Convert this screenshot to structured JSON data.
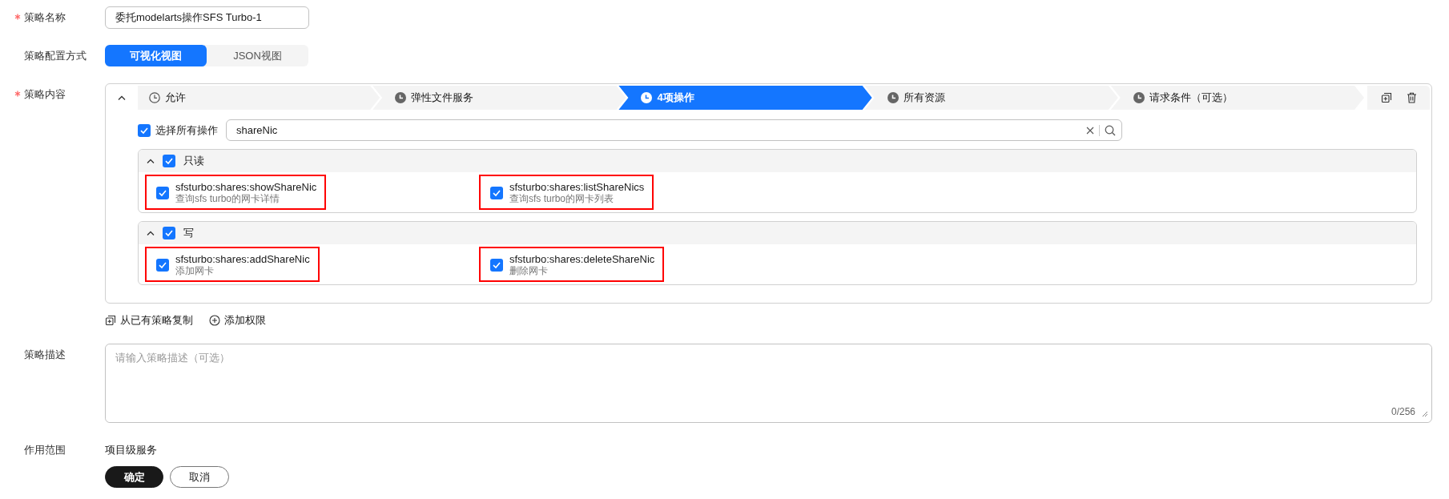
{
  "name_field": {
    "label": "策略名称",
    "required": true,
    "value": "委托modelarts操作SFS Turbo-1"
  },
  "config_mode": {
    "label": "策略配置方式",
    "required": false,
    "options": [
      {
        "label": "可视化视图",
        "selected": true
      },
      {
        "label": "JSON视图",
        "selected": false
      }
    ]
  },
  "policy_content": {
    "label": "策略内容",
    "required": true,
    "expanded": true,
    "steps": [
      {
        "label": "允许",
        "kind": "outline",
        "selected": false
      },
      {
        "label": "弹性文件服务",
        "kind": "filled",
        "selected": false
      },
      {
        "label": "4项操作",
        "kind": "filled",
        "selected": true
      },
      {
        "label": "所有资源",
        "kind": "filled",
        "selected": false
      },
      {
        "label": "请求条件（可选）",
        "kind": "filled",
        "selected": false
      }
    ],
    "select_all": {
      "label": "选择所有操作",
      "checked": true
    },
    "search": {
      "value": "shareNic"
    },
    "groups": [
      {
        "title": "只读",
        "checked": true,
        "expanded": true,
        "actions": [
          {
            "name": "sfsturbo:shares:showShareNic",
            "description": "查询sfs turbo的网卡详情",
            "checked": true,
            "highlighted": true
          },
          {
            "name": "sfsturbo:shares:listShareNics",
            "description": "查询sfs turbo的网卡列表",
            "checked": true,
            "highlighted": true
          }
        ]
      },
      {
        "title": "写",
        "checked": true,
        "expanded": true,
        "actions": [
          {
            "name": "sfsturbo:shares:addShareNic",
            "description": "添加网卡",
            "checked": true,
            "highlighted": true
          },
          {
            "name": "sfsturbo:shares:deleteShareNic",
            "description": "删除网卡",
            "checked": true,
            "highlighted": true
          }
        ]
      }
    ]
  },
  "links": [
    {
      "label": "从已有策略复制",
      "kind": "copy"
    },
    {
      "label": "添加权限",
      "kind": "add"
    }
  ],
  "description": {
    "label": "策略描述",
    "required": false,
    "placeholder": "请输入策略描述（可选）",
    "counter": "0/256"
  },
  "scope": {
    "label": "作用范围",
    "required": false,
    "value": "项目级服务"
  },
  "buttons": [
    {
      "label": "确定",
      "kind": "primary"
    },
    {
      "label": "取消",
      "kind": "secondary"
    }
  ]
}
